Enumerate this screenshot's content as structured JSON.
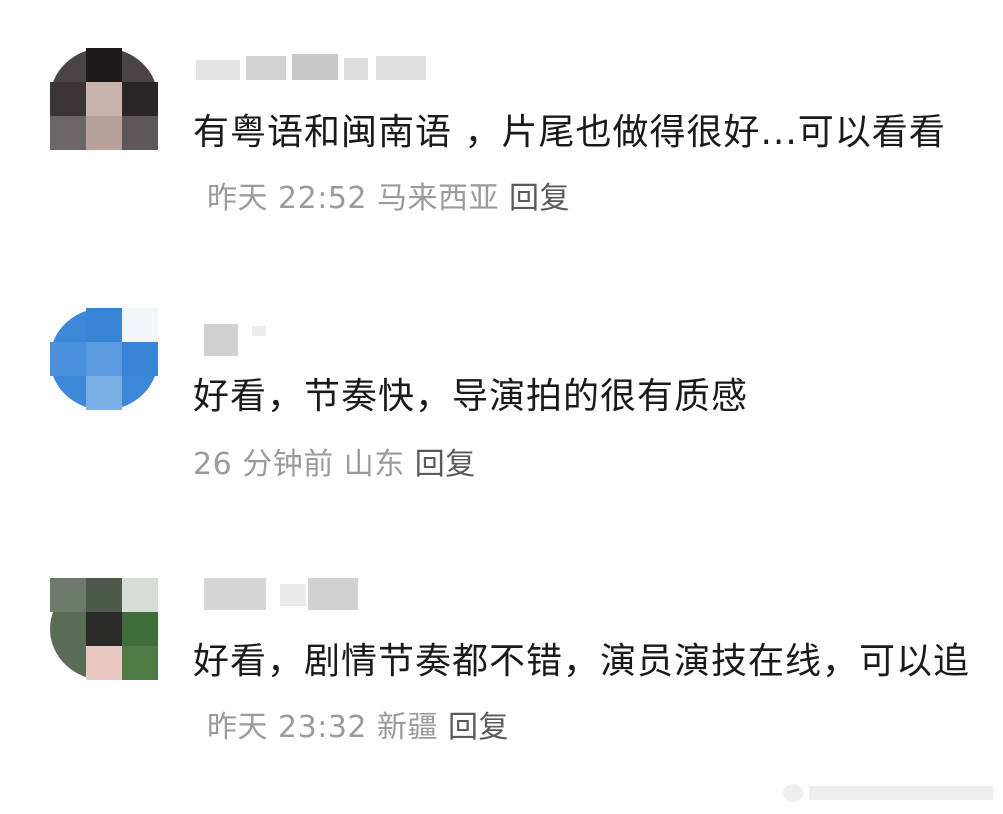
{
  "comments": [
    {
      "text": "有粤语和闽南语 ，片尾也做得很好...可以看看",
      "time": "昨天 22:52",
      "location": "马来西亚",
      "reply_label": "回复"
    },
    {
      "text": "好看，节奏快，导演拍的很有质感",
      "time": "26 分钟前",
      "location": "山东",
      "reply_label": "回复"
    },
    {
      "text": "好看，剧情节奏都不错，演员演技在线，可以追",
      "time": "昨天 23:32",
      "location": "新疆",
      "reply_label": "回复"
    }
  ],
  "colors": {
    "text": "#1a1a1a",
    "meta": "#9b9b9b",
    "reply": "#5a5a5a",
    "avatar_blue": "#3d88d8"
  },
  "icons": [
    "pixelated-avatar",
    "blurred-username",
    "watermark-logo"
  ]
}
